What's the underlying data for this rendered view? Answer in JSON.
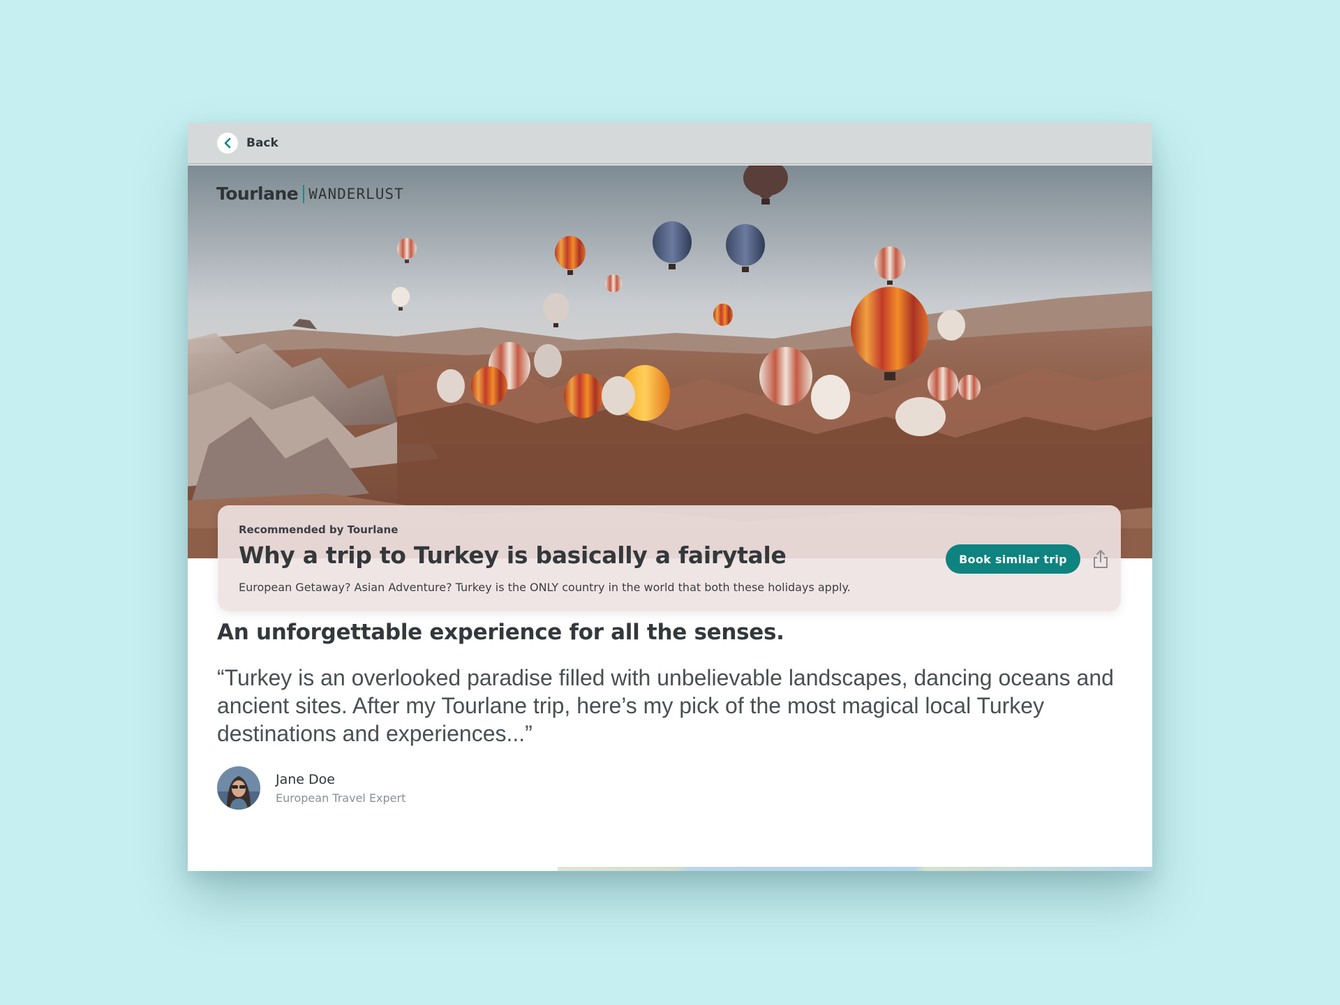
{
  "topbar": {
    "back_label": "Back",
    "back_icon": "chevron-left-icon"
  },
  "brand": {
    "name": "Tourlane",
    "sub": "WANDERLUST"
  },
  "hero": {
    "image": "hot-air-balloons-cappadocia-landscape",
    "eyebrow": "Recommended by Tourlane",
    "title": "Why a trip to Turkey is basically a fairytale",
    "description": "European Getaway? Asian Adventure? Turkey is the ONLY country in the world that both these holidays apply.",
    "cta_label": "Book similar trip",
    "share_icon": "share-icon"
  },
  "article": {
    "headline": "An unforgettable experience for all the senses.",
    "quote": "“Turkey is an overlooked paradise filled with unbelievable landscapes, dancing oceans and ancient sites. After my Tourlane trip, here’s my pick of the most magical local Turkey destinations and experiences...”",
    "author": {
      "name": "Jane Doe",
      "role": "European Travel Expert"
    }
  },
  "colors": {
    "page_background": "#c6eff1",
    "accent": "#0e8380",
    "topbar": "#d5d9d9"
  }
}
